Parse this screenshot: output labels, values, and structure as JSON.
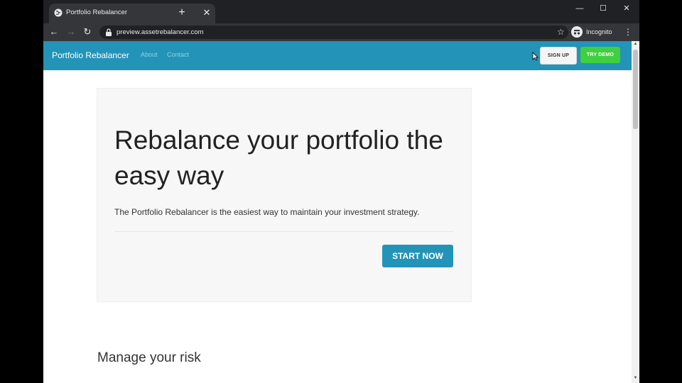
{
  "browser": {
    "tab_title": "Portfolio Rebalancer",
    "url": "preview.assetrebalancer.com",
    "profile_label": "Incognito"
  },
  "site": {
    "brand": "Portfolio Rebalancer",
    "nav_links": [
      "About",
      "Contact"
    ],
    "signup_label": "SIGN UP",
    "demo_label": "TRY DEMO"
  },
  "hero": {
    "title": "Rebalance your portfolio the easy way",
    "subtitle": "The Portfolio Rebalancer is the easiest way to maintain your investment strategy.",
    "cta_label": "START NOW"
  },
  "section": {
    "title": "Manage your risk"
  },
  "colors": {
    "brand_blue": "#2493b8",
    "demo_green": "#3fcf3f"
  },
  "icons": [
    "globe-icon",
    "close-icon",
    "plus-icon",
    "minimize-icon",
    "maximize-icon",
    "back-arrow-icon",
    "forward-arrow-icon",
    "reload-icon",
    "lock-icon",
    "star-icon",
    "incognito-icon",
    "kebab-menu-icon",
    "cursor-icon"
  ]
}
